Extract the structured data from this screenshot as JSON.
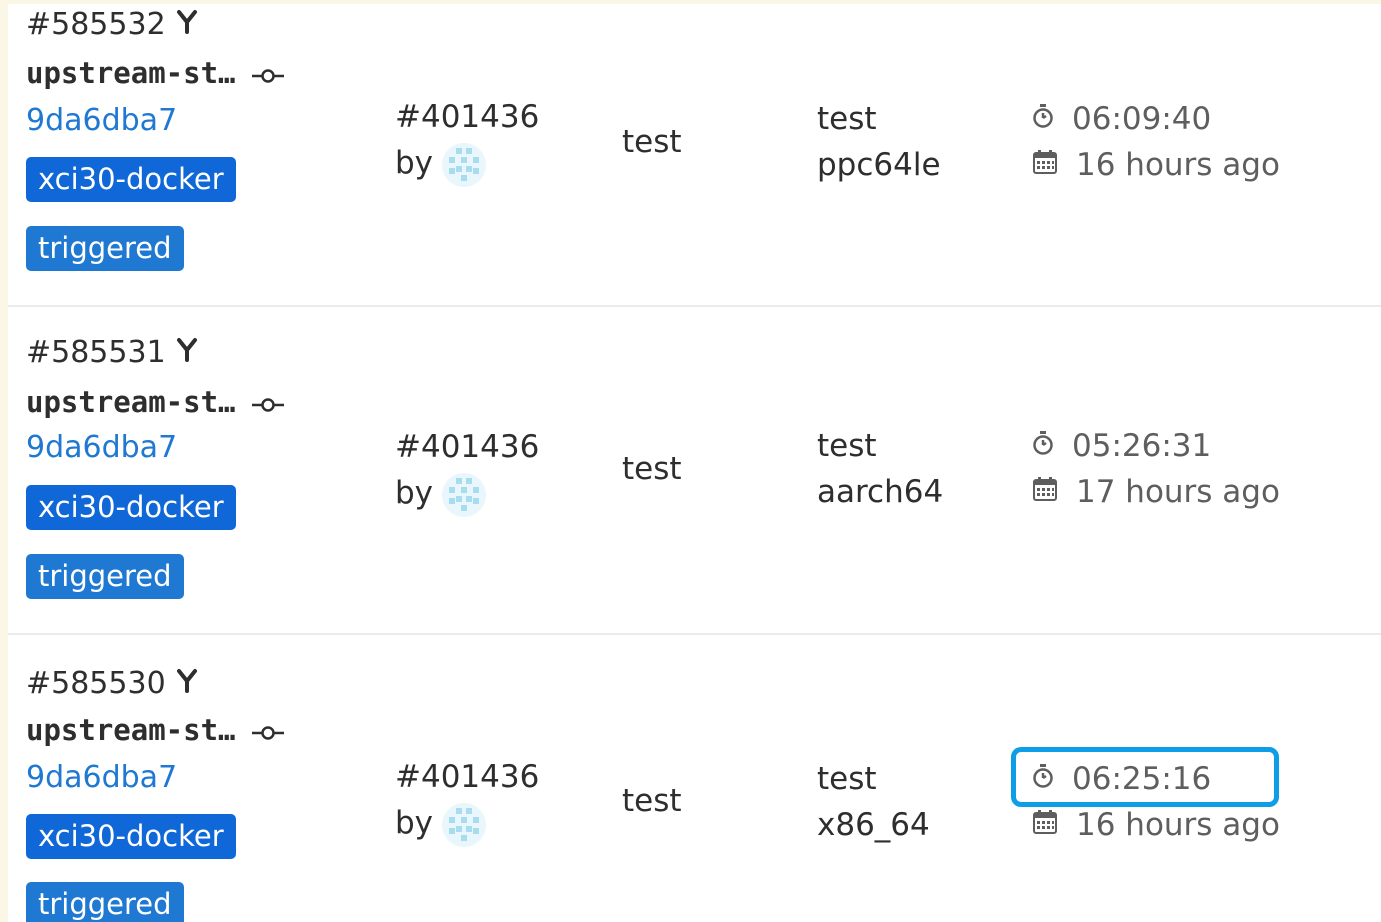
{
  "jobs": [
    {
      "id": "#585532",
      "branch": "upstream-st…",
      "sha": "9da6dba7",
      "runner_tag": "xci30-docker",
      "trigger_tag": "triggered",
      "pipeline": "#401436",
      "by_label": "by",
      "stage": "test",
      "name_line1": "test",
      "name_line2": "ppc64le",
      "duration": "06:09:40",
      "finished": "16 hours ago"
    },
    {
      "id": "#585531",
      "branch": "upstream-st…",
      "sha": "9da6dba7",
      "runner_tag": "xci30-docker",
      "trigger_tag": "triggered",
      "pipeline": "#401436",
      "by_label": "by",
      "stage": "test",
      "name_line1": "test",
      "name_line2": "aarch64",
      "duration": "05:26:31",
      "finished": "17 hours ago"
    },
    {
      "id": "#585530",
      "branch": "upstream-st…",
      "sha": "9da6dba7",
      "runner_tag": "xci30-docker",
      "trigger_tag": "triggered",
      "pipeline": "#401436",
      "by_label": "by",
      "stage": "test",
      "name_line1": "test",
      "name_line2": "x86_64",
      "duration": "06:25:16",
      "finished": "16 hours ago"
    }
  ],
  "icons": {
    "fork": "fork-icon",
    "commit": "commit-icon",
    "timer": "timer-icon",
    "calendar": "calendar-icon",
    "avatar": "avatar-identicon"
  },
  "colors": {
    "link": "#1f78d1",
    "badge": "#1068d8",
    "highlight": "#0d9ee7",
    "background": "#fbf7e6"
  }
}
